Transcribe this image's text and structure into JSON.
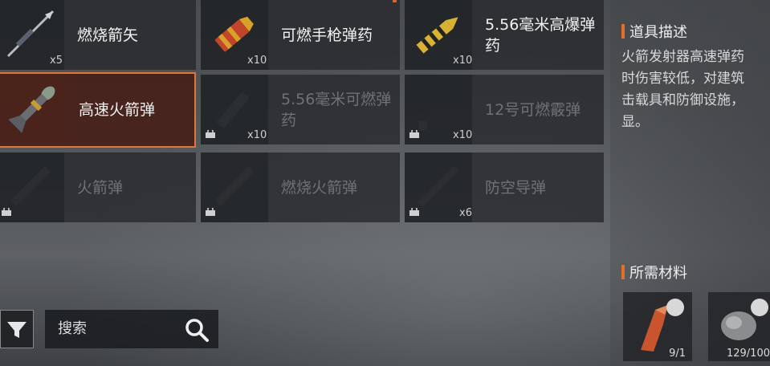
{
  "items": [
    {
      "name": "燃烧箭矢",
      "count": "x5",
      "locked": false,
      "selected": false,
      "icon": "arrow-icon"
    },
    {
      "name": "可燃手枪弹药",
      "count": "x10",
      "locked": false,
      "selected": false,
      "icon": "pistol-ammo-icon"
    },
    {
      "name": "5.56毫米高爆弹药",
      "count": "x10",
      "locked": false,
      "selected": false,
      "icon": "rifle-ammo-icon"
    },
    {
      "name": "高速火箭弹",
      "count": "",
      "locked": false,
      "selected": true,
      "icon": "rocket-icon"
    },
    {
      "name": "5.56毫米可燃弹药",
      "count": "x10",
      "locked": true,
      "selected": false,
      "icon": "rifle-ammo-icon"
    },
    {
      "name": "12号可燃霰弹",
      "count": "x10",
      "locked": true,
      "selected": false,
      "icon": "shotgun-shell-icon"
    },
    {
      "name": "火箭弹",
      "count": "",
      "locked": true,
      "selected": false,
      "icon": "rocket-icon"
    },
    {
      "name": "燃烧火箭弹",
      "count": "",
      "locked": true,
      "selected": false,
      "icon": "rocket-icon"
    },
    {
      "name": "防空导弹",
      "count": "x6",
      "locked": true,
      "selected": false,
      "icon": "missile-icon"
    }
  ],
  "panel": {
    "desc_title": "道具描述",
    "desc_text": "火箭发射器高速弹药\n时伤害较低，对建筑\n击载具和防御设施，\n显。",
    "mat_title": "所需材料",
    "materials": [
      {
        "count": "9/1",
        "icon": "cloth-icon"
      },
      {
        "count": "129/100",
        "icon": "ore-icon"
      }
    ]
  },
  "search": {
    "placeholder": "搜索"
  },
  "colors": {
    "accent": "#e0702a",
    "selected_bg": "#461e16",
    "cell_bg": "#282a2d"
  }
}
